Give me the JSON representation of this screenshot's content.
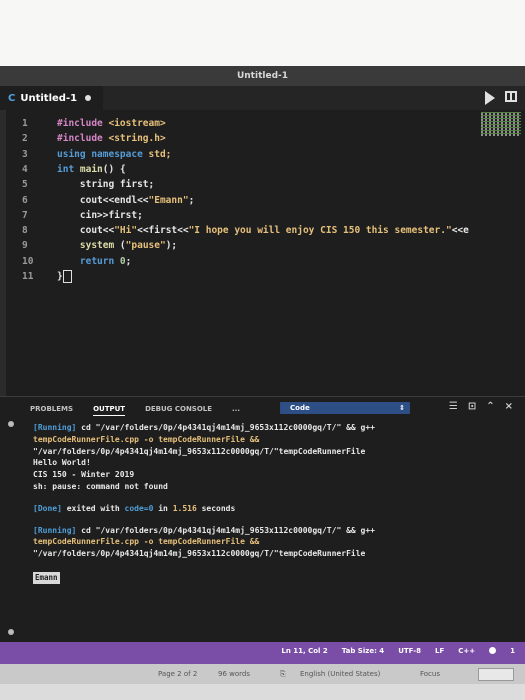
{
  "window": {
    "title": "Untitled-1"
  },
  "tab": {
    "label": "Untitled-1"
  },
  "editor": {
    "lines": [
      {
        "num": "1",
        "parts": [
          {
            "c": "inc",
            "t": "#include "
          },
          {
            "c": "ang",
            "t": "<iostream>"
          }
        ]
      },
      {
        "num": "2",
        "parts": [
          {
            "c": "inc",
            "t": "#include "
          },
          {
            "c": "ang",
            "t": "<string.h>"
          }
        ]
      },
      {
        "num": "3",
        "parts": [
          {
            "c": "kw",
            "t": "using namespace "
          },
          {
            "c": "str",
            "t": "std;"
          }
        ]
      },
      {
        "num": "4",
        "parts": [
          {
            "c": "kw",
            "t": "int "
          },
          {
            "c": "fn",
            "t": "main"
          },
          {
            "c": "",
            "t": "() {"
          }
        ]
      },
      {
        "num": "5",
        "parts": [
          {
            "c": "",
            "t": "    string first;"
          }
        ]
      },
      {
        "num": "6",
        "parts": [
          {
            "c": "",
            "t": "    cout<<endl<<"
          },
          {
            "c": "str",
            "t": "\"Emann\""
          },
          {
            "c": "",
            "t": ";"
          }
        ]
      },
      {
        "num": "7",
        "parts": [
          {
            "c": "",
            "t": "    cin>>first;"
          }
        ]
      },
      {
        "num": "8",
        "parts": [
          {
            "c": "",
            "t": "    cout<<"
          },
          {
            "c": "str",
            "t": "\"Hi\""
          },
          {
            "c": "",
            "t": "<<first<<"
          },
          {
            "c": "str",
            "t": "\"I hope you will enjoy CIS 150 this semester.\""
          },
          {
            "c": "",
            "t": "<<e"
          }
        ]
      },
      {
        "num": "9",
        "parts": [
          {
            "c": "fn",
            "t": "    system "
          },
          {
            "c": "",
            "t": "("
          },
          {
            "c": "str",
            "t": "\"pause\""
          },
          {
            "c": "",
            "t": ");"
          }
        ]
      },
      {
        "num": "10",
        "parts": [
          {
            "c": "kw",
            "t": "    return "
          },
          {
            "c": "num",
            "t": "0"
          },
          {
            "c": "",
            "t": ";"
          }
        ]
      },
      {
        "num": "11",
        "parts": [
          {
            "c": "",
            "t": "}"
          }
        ]
      }
    ]
  },
  "panel": {
    "tabs": [
      "PROBLEMS",
      "OUTPUT",
      "DEBUG CONSOLE",
      "..."
    ],
    "active_tab": "OUTPUT",
    "select_value": "Code",
    "output": [
      {
        "c": "mix",
        "parts": [
          {
            "c": "blue",
            "t": "[Running] "
          },
          {
            "c": "gre",
            "t": "cd \"/var/folders/0p/4p4341qj4m14mj_9653x112c0000gq/T/\" && g++"
          }
        ]
      },
      {
        "c": "yel",
        "t": "tempCodeRunnerFile.cpp -o tempCodeRunnerFile &&"
      },
      {
        "c": "gre",
        "t": "\"/var/folders/0p/4p4341qj4m14mj_9653x112c0000gq/T/\"tempCodeRunnerFile"
      },
      {
        "c": "gre",
        "t": "Hello World!"
      },
      {
        "c": "gre",
        "t": "CIS 150 - Winter 2019"
      },
      {
        "c": "gre",
        "t": "sh: pause: command not found"
      },
      {
        "c": "gap",
        "t": ""
      },
      {
        "c": "mix",
        "parts": [
          {
            "c": "blue",
            "t": "[Done] "
          },
          {
            "c": "gre",
            "t": "exited with "
          },
          {
            "c": "blue",
            "t": "code=0"
          },
          {
            "c": "gre",
            "t": " in "
          },
          {
            "c": "yel",
            "t": "1.516"
          },
          {
            "c": "gre",
            "t": " seconds"
          }
        ]
      },
      {
        "c": "gap",
        "t": ""
      },
      {
        "c": "mix",
        "parts": [
          {
            "c": "blue",
            "t": "[Running] "
          },
          {
            "c": "gre",
            "t": "cd \"/var/folders/0p/4p4341qj4m14mj_9653x112c0000gq/T/\" && g++"
          }
        ]
      },
      {
        "c": "yel",
        "t": "tempCodeRunnerFile.cpp -o tempCodeRunnerFile &&"
      },
      {
        "c": "gre",
        "t": "\"/var/folders/0p/4p4341qj4m14mj_9653x112c0000gq/T/\"tempCodeRunnerFile"
      }
    ],
    "input_text": "Emann"
  },
  "status": {
    "position": "Ln 11, Col 2",
    "tab_size": "Tab Size: 4",
    "encoding": "UTF-8",
    "eol": "LF",
    "language": "C++",
    "notifications": "1"
  },
  "word_status": {
    "page": "Page 2 of 2",
    "words": "96 words",
    "language": "English (United States)",
    "focus": "Focus"
  },
  "colors": {
    "status_bar": "#7a4ea6",
    "editor_bg": "#1e1e1e"
  }
}
